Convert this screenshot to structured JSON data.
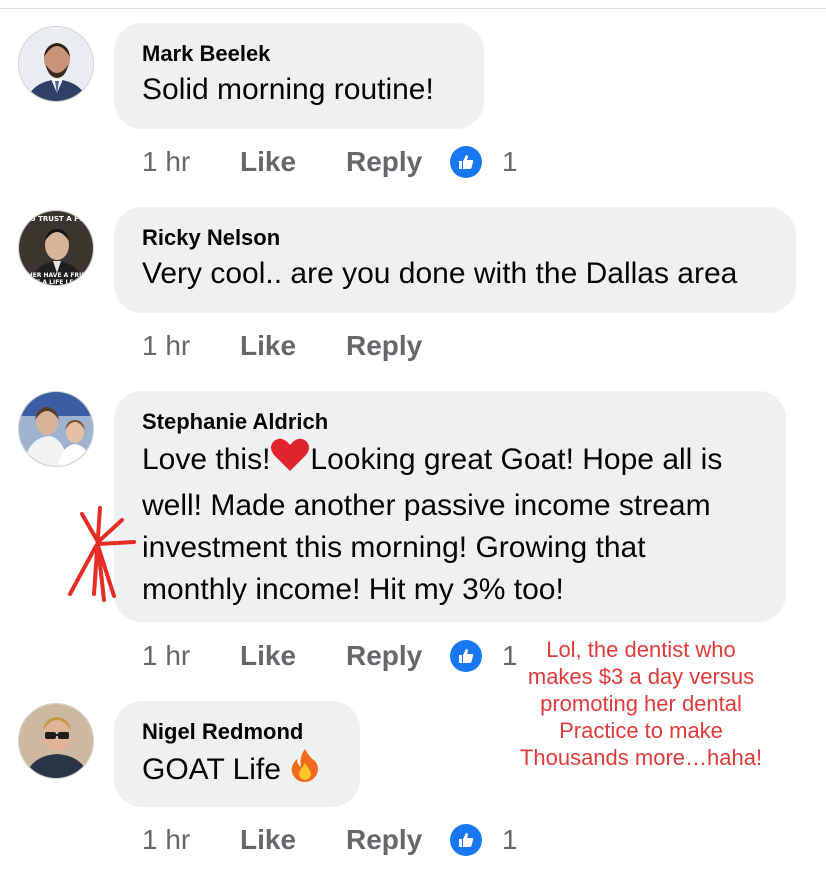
{
  "comments": [
    {
      "author": "Mark Beelek",
      "text": "Solid morning routine!",
      "time": "1 hr",
      "like_label": "Like",
      "reply_label": "Reply",
      "reactions": "1"
    },
    {
      "author": "Ricky Nelson",
      "text": "Very cool.. are you done with the Dallas area",
      "time": "1 hr",
      "like_label": "Like",
      "reply_label": "Reply",
      "avatar_caption_top": "U TRUST A PE",
      "avatar_caption_bottom": "THER HAVE A FRIEN\nE A LIFE LES"
    },
    {
      "author": "Stephanie Aldrich",
      "text_before_emoji": "Love this!",
      "text_line1_after": "Looking great Goat! Hope all is",
      "text_line2": "well! Made another passive income stream",
      "text_line3": "investment this morning! Growing that",
      "text_line4": "monthly income! Hit my 3% too!",
      "emoji": "red-heart",
      "time": "1 hr",
      "like_label": "Like",
      "reply_label": "Reply",
      "reactions": "1"
    },
    {
      "author": "Nigel Redmond",
      "text": "GOAT Life",
      "emoji": "fire",
      "time": "1 hr",
      "like_label": "Like",
      "reply_label": "Reply",
      "reactions": "1"
    }
  ],
  "annotation": {
    "line1": "Lol, the dentist who",
    "line2": "makes $3 a day versus",
    "line3": "promoting her dental",
    "line4": "Practice to make",
    "line5": "Thousands more…haha!",
    "color": "#e03a3a"
  },
  "colors": {
    "bubble": "#eff0f2",
    "meta_text": "#65676b",
    "like_badge": "#1877f2"
  }
}
